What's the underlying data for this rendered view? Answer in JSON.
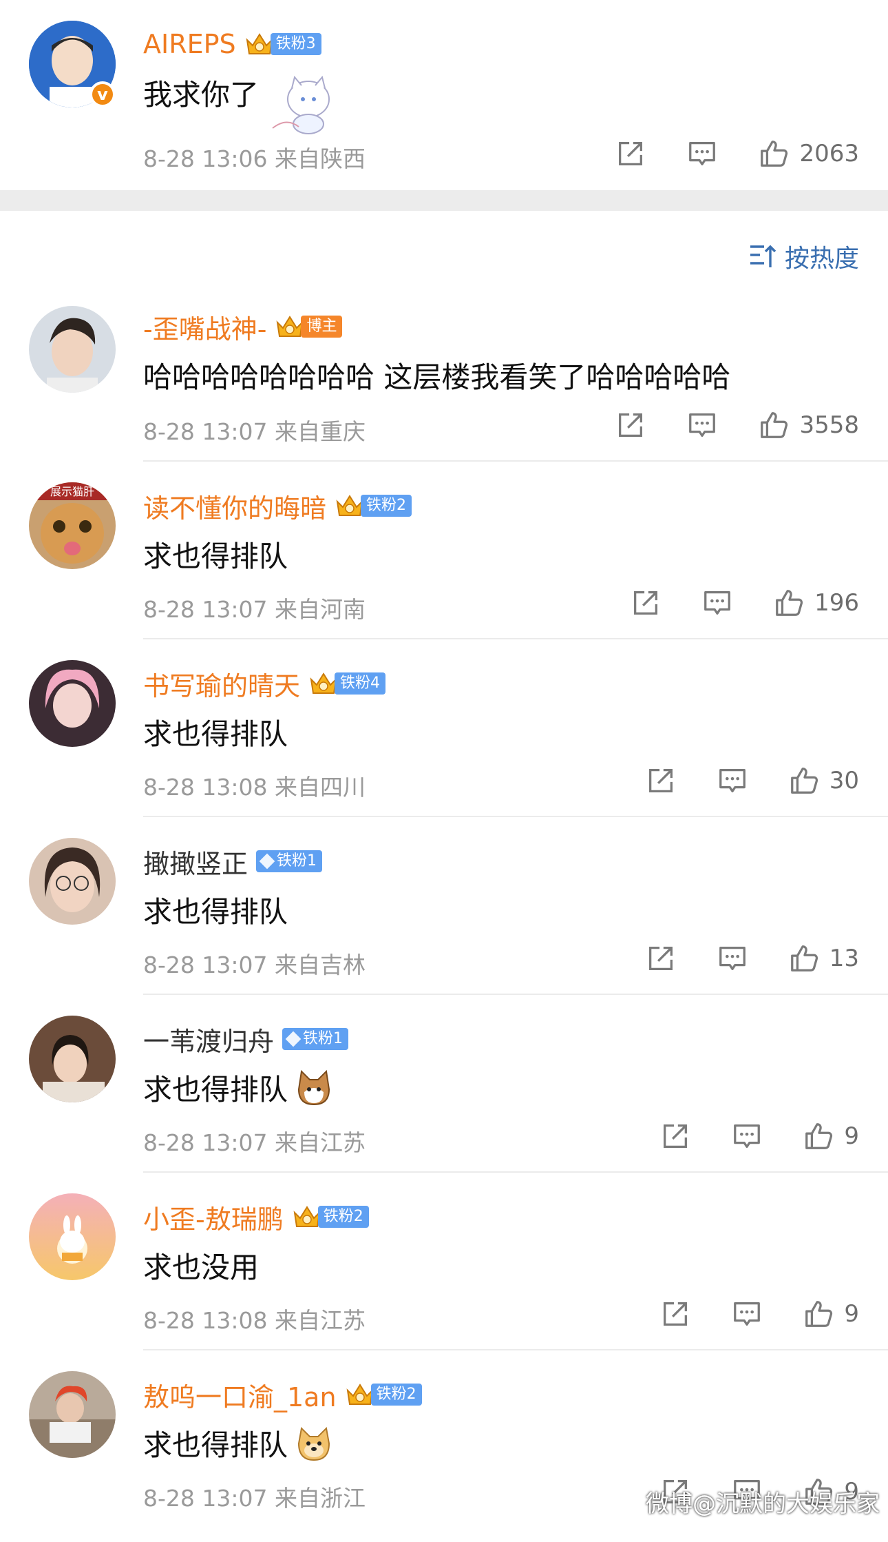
{
  "post": {
    "username": "AIREPS",
    "badge": "铁粉3",
    "content": "我求你了",
    "meta": "8-28 13:06  来自陕西",
    "likes": "2063"
  },
  "sort_label": "按热度",
  "comments": [
    {
      "username": "-歪嘴战神-",
      "badge": "博主",
      "content": "哈哈哈哈哈哈哈哈 这层楼我看笑了哈哈哈哈哈",
      "meta": "8-28 13:07  来自重庆",
      "likes": "3558"
    },
    {
      "username": "读不懂你的晦暗",
      "badge": "铁粉2",
      "content": "求也得排队",
      "meta": "8-28 13:07  来自河南",
      "likes": "196"
    },
    {
      "username": "书写瑜的晴天",
      "badge": "铁粉4",
      "content": "求也得排队",
      "meta": "8-28 13:08  来自四川",
      "likes": "30"
    },
    {
      "username": "撖撖竖正",
      "badge": "铁粉1",
      "content": "求也得排队",
      "meta": "8-28 13:07  来自吉林",
      "likes": "13"
    },
    {
      "username": "一苇渡归舟",
      "badge": "铁粉1",
      "content": "求也得排队",
      "meta": "8-28 13:07  来自江苏",
      "likes": "9"
    },
    {
      "username": "小歪-敖瑞鹏",
      "badge": "铁粉2",
      "content": "求也没用",
      "meta": "8-28 13:08  来自江苏",
      "likes": "9"
    },
    {
      "username": "敖呜一口渝_1an",
      "badge": "铁粉2",
      "content": "求也得排队",
      "meta": "8-28 13:07  来自浙江",
      "likes": "9"
    }
  ],
  "avatar_texts": {
    "c2": "展示猫肝"
  },
  "watermark": "微博@沉默的大娱乐家",
  "colors": {
    "username_orange": "#ef7b21",
    "badge_blue": "#5fa0f2",
    "sort_blue": "#3a6fb0",
    "meta_gray": "#9a9a9a"
  }
}
